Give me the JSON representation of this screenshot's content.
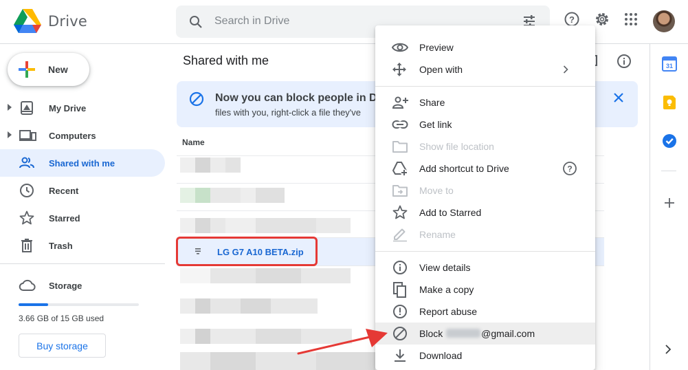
{
  "app": {
    "name": "Drive"
  },
  "search": {
    "placeholder": "Search in Drive"
  },
  "sidebar": {
    "new_label": "New",
    "items": [
      {
        "label": "My Drive",
        "icon": "my-drive-icon"
      },
      {
        "label": "Computers",
        "icon": "computers-icon"
      },
      {
        "label": "Shared with me",
        "icon": "shared-icon",
        "active": true
      },
      {
        "label": "Recent",
        "icon": "clock-icon"
      },
      {
        "label": "Starred",
        "icon": "star-icon"
      },
      {
        "label": "Trash",
        "icon": "trash-icon"
      }
    ],
    "storage_label": "Storage",
    "storage_used_text": "3.66 GB of 15 GB used",
    "storage_fraction": 0.244,
    "buy_storage_label": "Buy storage"
  },
  "main": {
    "title": "Shared with me",
    "banner": {
      "title": "Now you can block people in Dr",
      "body": "files with you, right-click a file they've"
    },
    "column_name": "Name",
    "selected_file": "LG G7 A10 BETA.zip"
  },
  "context_menu": {
    "items": [
      {
        "label": "Preview",
        "icon": "eye-icon"
      },
      {
        "label": "Open with",
        "icon": "move-arrows-icon",
        "submenu": true
      },
      {
        "label": "Share",
        "icon": "add-person-icon"
      },
      {
        "label": "Get link",
        "icon": "link-icon"
      },
      {
        "label": "Show file location",
        "icon": "folder-icon",
        "disabled": true
      },
      {
        "label": "Add shortcut to Drive",
        "icon": "add-shortcut-icon",
        "help": true
      },
      {
        "label": "Move to",
        "icon": "move-to-folder-icon",
        "disabled": true
      },
      {
        "label": "Add to Starred",
        "icon": "star-icon"
      },
      {
        "label": "Rename",
        "icon": "pencil-icon",
        "disabled": true
      },
      {
        "label": "View details",
        "icon": "info-icon"
      },
      {
        "label": "Make a copy",
        "icon": "copy-icon"
      },
      {
        "label": "Report abuse",
        "icon": "alert-icon"
      },
      {
        "label": "Block",
        "suffix": "@gmail.com",
        "icon": "block-icon",
        "highlighted": true
      },
      {
        "label": "Download",
        "icon": "download-icon"
      }
    ]
  },
  "colors": {
    "accent": "#1a73e8",
    "active_nav_bg": "#e8f0fe",
    "annotation_red": "#e53935"
  }
}
